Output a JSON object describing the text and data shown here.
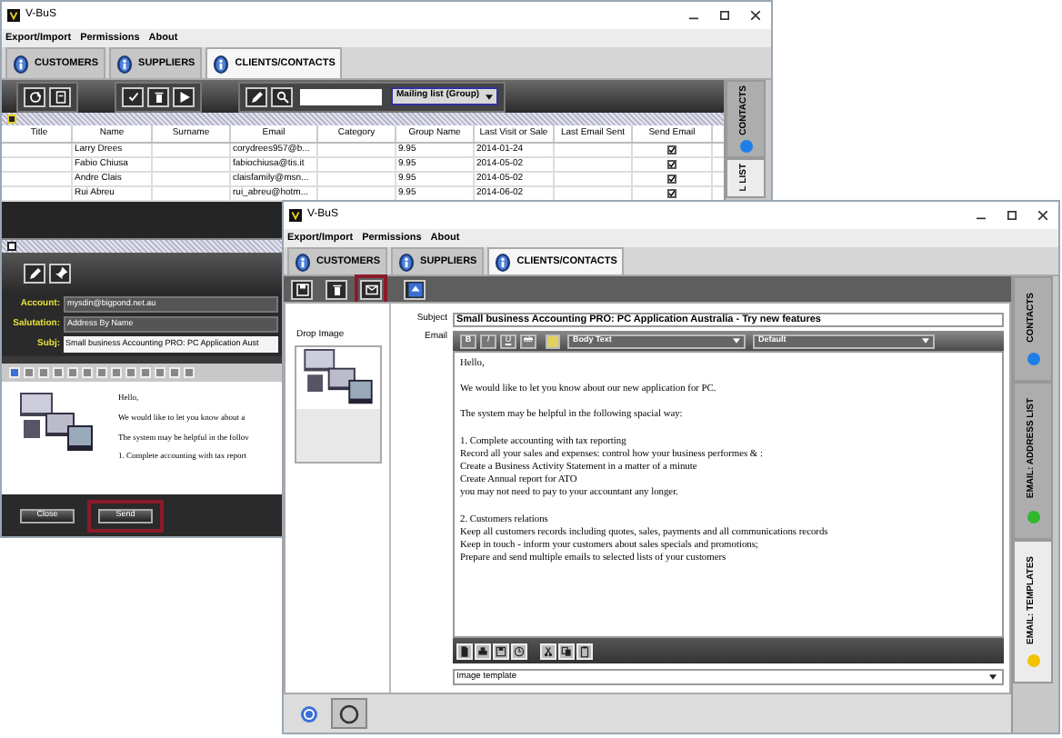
{
  "back_window": {
    "title": "V-BuS",
    "menu": [
      "Export/Import",
      "Permissions",
      "About"
    ],
    "tabs": [
      {
        "label": "CUSTOMERS",
        "selected": false
      },
      {
        "label": "SUPPLIERS",
        "selected": false
      },
      {
        "label": "CLIENTS/CONTACTS",
        "selected": true
      }
    ],
    "toolbar_groups": [
      [
        {
          "kind": "refresh"
        },
        {
          "kind": "clipboard"
        }
      ],
      [
        {
          "kind": "check"
        },
        {
          "kind": "trash"
        },
        {
          "kind": "send"
        }
      ],
      [
        {
          "kind": "pen"
        },
        {
          "kind": "search"
        }
      ]
    ],
    "group_dropdown": "Mailing list (Group)",
    "table": {
      "columns": [
        "Title",
        "Name",
        "Surname",
        "Email",
        "Category",
        "Group Name",
        "Last Visit or Sale",
        "Last Email Sent",
        "Send Email"
      ],
      "rows": [
        {
          "name": "Larry Drees",
          "email": "corydrees957@b...",
          "group_name": "9.95",
          "last_visit": "2014-01-24",
          "send_email": true
        },
        {
          "name": "Fabio Chiusa",
          "email": "fabiochiusa@tis.it",
          "group_name": "9.95",
          "last_visit": "2014-05-02",
          "send_email": true
        },
        {
          "name": "Andre Clais",
          "email": "claisfamily@msn...",
          "group_name": "9.95",
          "last_visit": "2014-05-02",
          "send_email": true
        },
        {
          "name": "Rui Abreu",
          "email": "rui_abreu@hotm...",
          "group_name": "9.95",
          "last_visit": "2014-06-02",
          "send_email": true
        }
      ]
    },
    "side_tabs": [
      {
        "label": "CONTACTS",
        "color": "#1f7fe8",
        "selected": false
      },
      {
        "label": "L LIST",
        "selected": true
      }
    ]
  },
  "email_dialog": {
    "toolbar": [
      {
        "kind": "pen"
      },
      {
        "kind": "pin"
      }
    ],
    "fields": [
      {
        "label": "Account:",
        "value": "mysdin@bigpond.net.au",
        "kind": "dark"
      },
      {
        "label": "Salutation:",
        "value": "Address By Name",
        "kind": "dark"
      },
      {
        "label": "Subj:",
        "value": "Small business Accounting PRO: PC Application Aust",
        "kind": "light"
      }
    ],
    "body_lines": [
      "Hello,",
      "We would like to let you know about a",
      "The system may be helpful in the follov",
      "1. Complete accounting with tax report"
    ],
    "buttons": [
      {
        "label": "Close",
        "highlighted": false
      },
      {
        "label": "Send",
        "highlighted": true
      }
    ]
  },
  "front_window": {
    "title": "V-BuS",
    "menu": [
      "Export/Import",
      "Permissions",
      "About"
    ],
    "tabs": [
      {
        "label": "CUSTOMERS",
        "selected": false
      },
      {
        "label": "SUPPLIERS",
        "selected": false
      },
      {
        "label": "CLIENTS/CONTACTS",
        "selected": true
      }
    ],
    "toolbar": [
      {
        "kind": "save",
        "highlighted": false
      },
      {
        "kind": "trash",
        "highlighted": false
      },
      {
        "kind": "email",
        "highlighted": true
      },
      {
        "kind": "up",
        "highlighted": false
      }
    ],
    "drop_image_label": "Drop Image",
    "subject_label": "Subject",
    "subject": "Small business Accounting PRO: PC Application Australia - Try new features",
    "email_label": "Email",
    "format_buttons": [
      "B",
      "I",
      "U",
      "ab"
    ],
    "style_dropdown": "Body Text",
    "font_dropdown": "Default",
    "body_paragraphs": [
      [
        "Hello,"
      ],
      [
        "We would like to let you know about our new application for PC."
      ],
      [
        "The system may be helpful in the following spacial way:"
      ],
      [
        "1. Complete accounting with tax reporting",
        "Record all your sales and expenses: control how your business performes & :",
        "Create a Business Activity Statement in a matter of a minute",
        "Create Annual report for ATO",
        "you may not need to pay to your accountant any longer."
      ],
      [
        "2. Customers relations",
        "Keep all customers records including quotes, sales, payments and all communications records",
        "Keep in touch - inform your customers about sales specials and promotions;",
        "Prepare and send multiple emails to selected lists of your customers"
      ]
    ],
    "editor_tools": [
      {
        "kind": "open"
      },
      {
        "kind": "print"
      },
      {
        "kind": "save"
      },
      {
        "kind": "clock"
      },
      {
        "kind": "cut"
      },
      {
        "kind": "copy"
      },
      {
        "kind": "paste"
      }
    ],
    "image_template": "Image template",
    "side_tabs": [
      {
        "label": "CONTACTS",
        "color": "#1f7fe8",
        "selected": false
      },
      {
        "label": "EMAIL: ADDRESS LIST",
        "color": "#2fb82f",
        "selected": false
      },
      {
        "label": "EMAIL: TEMPLATES",
        "color": "#f2c200",
        "selected": true
      }
    ],
    "footer_buttons": [
      {
        "kind": "globe",
        "selected": false
      },
      {
        "kind": "ring",
        "selected": true
      }
    ]
  }
}
